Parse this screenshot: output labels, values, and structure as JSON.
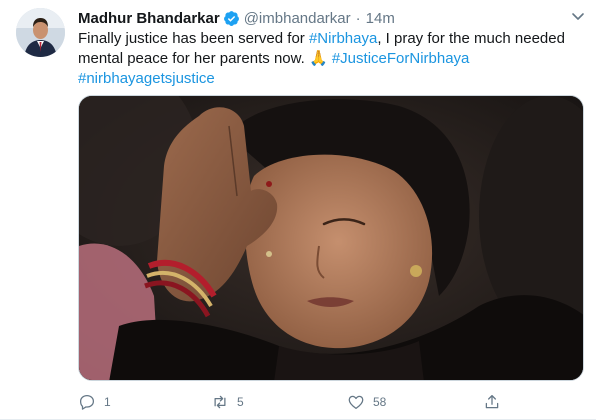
{
  "tweet": {
    "author_name": "Madhur Bhandarkar",
    "handle": "@imbhandarkar",
    "separator": "·",
    "time": "14m",
    "text": {
      "part1": "Finally justice has been served for ",
      "hashtag1": "#Nirbhaya",
      "part2": ", I pray for the much needed mental peace for her parents now. ",
      "emoji": "🙏",
      "space": " ",
      "hashtag2": "#JusticeForNirbhaya",
      "hashtag3": "#nirbhayagetsjustice"
    },
    "media_icon": "photo",
    "actions": {
      "reply_count": "1",
      "retweet_count": "5",
      "like_count": "58"
    }
  },
  "icons": {
    "verified": "verified-badge-icon",
    "more": "chevron-down-icon",
    "reply": "reply-icon",
    "retweet": "retweet-icon",
    "like": "heart-icon",
    "share": "share-icon"
  },
  "colors": {
    "link": "#1b95e0",
    "verified": "#1da1f2",
    "muted": "#657786"
  }
}
